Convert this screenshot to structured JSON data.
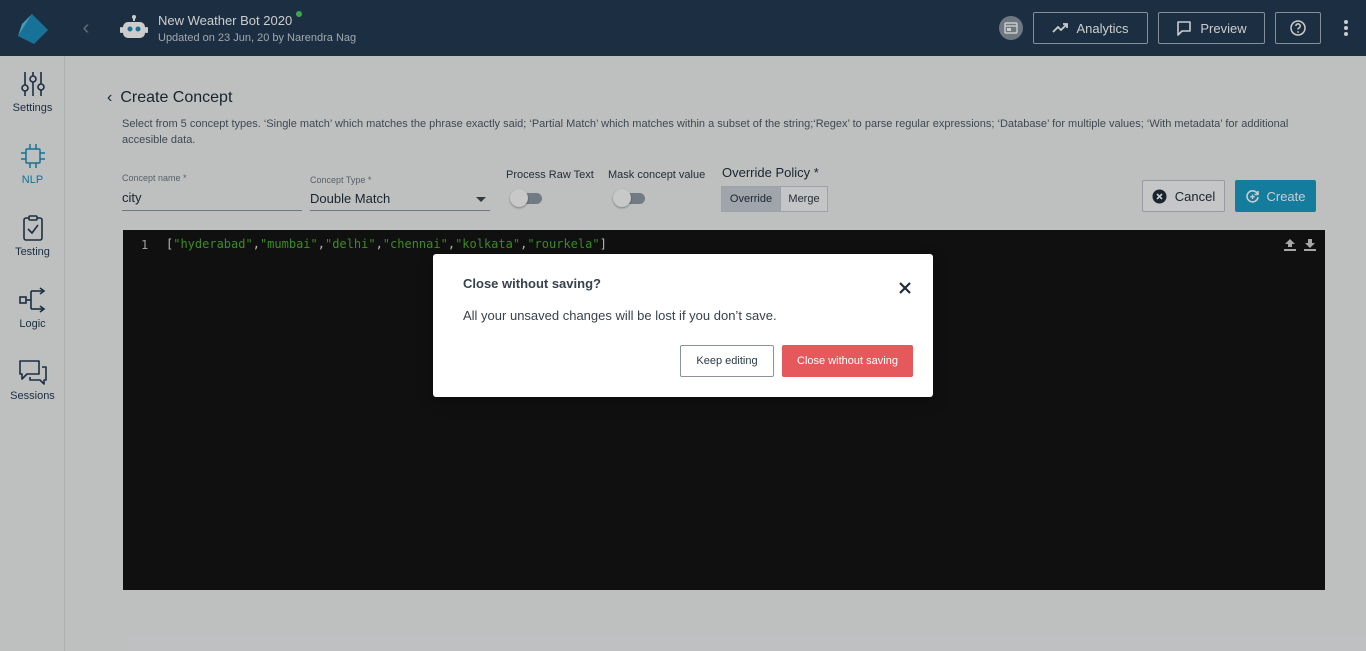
{
  "header": {
    "bot_name": "New Weather Bot 2020",
    "updated": "Updated on 23 Jun, 20 by Narendra Nag",
    "analytics_label": "Analytics",
    "preview_label": "Preview"
  },
  "sidebar": {
    "items": [
      {
        "label": "Settings",
        "icon": "sliders-icon"
      },
      {
        "label": "NLP",
        "icon": "chip-icon",
        "active": true
      },
      {
        "label": "Testing",
        "icon": "clipboard-check-icon"
      },
      {
        "label": "Logic",
        "icon": "flow-icon"
      },
      {
        "label": "Sessions",
        "icon": "chat-bubbles-icon"
      }
    ]
  },
  "page": {
    "title": "Create Concept",
    "description": "Select from 5 concept types. ‘Single match’ which matches the phrase exactly said; ‘Partial Match’ which matches within a subset of the string;‘Regex’ to parse regular expressions; ‘Database’ for multiple values; ‘With metadata’ for additional accesible data."
  },
  "form": {
    "concept_name_label": "Concept name *",
    "concept_name_value": "city",
    "concept_type_label": "Concept Type *",
    "concept_type_value": "Double Match",
    "process_raw_text_label": "Process Raw Text",
    "process_raw_text_on": false,
    "mask_concept_value_label": "Mask concept value",
    "mask_concept_value_on": false,
    "override_policy_label": "Override Policy *",
    "override_option": "Override",
    "merge_option": "Merge",
    "cancel_label": "Cancel",
    "create_label": "Create"
  },
  "editor": {
    "line_number": "1",
    "code_prefix": "[",
    "code_suffix": "]",
    "values": [
      "\"hyderabad\"",
      "\"mumbai\"",
      "\"delhi\"",
      "\"chennai\"",
      "\"kolkata\"",
      "\"rourkela\""
    ],
    "string_color": "#4caf2a"
  },
  "modal": {
    "title": "Close without saving?",
    "body": "All your unsaved changes will be lost if you don’t save.",
    "keep_label": "Keep editing",
    "close_label": "Close without saving",
    "danger_color": "#e5585b"
  },
  "colors": {
    "topbar": "#243b53",
    "accent": "#1a9bc5"
  }
}
